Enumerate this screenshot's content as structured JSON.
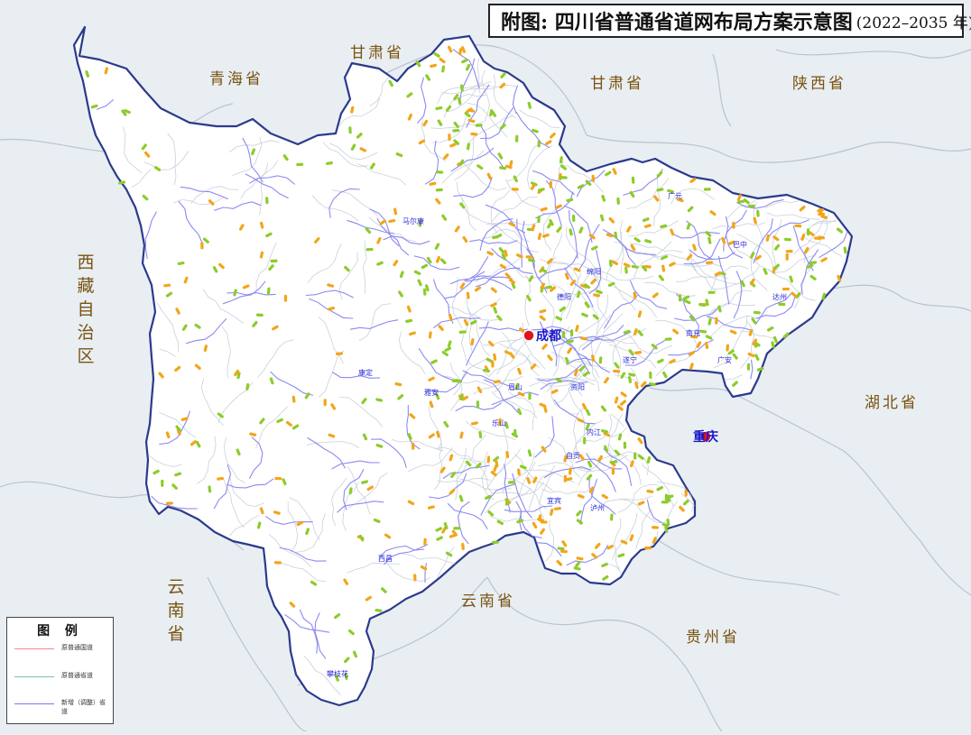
{
  "title": {
    "main": "附图: 四川省普通省道网布局方案示意图",
    "years": "(2022–2035 年)"
  },
  "neighbors": {
    "qinghai": "青海省",
    "gansu_north": "甘肃省",
    "gansu_east": "甘肃省",
    "shaanxi": "陕西省",
    "tibet_chars": [
      "西",
      "藏",
      "自",
      "治",
      "区"
    ],
    "hubei": "湖北省",
    "yunnan_west_chars": [
      "云",
      "南",
      "省"
    ],
    "yunnan_south": "云南省",
    "guizhou": "贵州省"
  },
  "cities": {
    "chengdu": "成都",
    "chongqing": "重庆",
    "guangyuan": "广元",
    "bazhong": "巴中",
    "mianyang": "绵阳",
    "deyang": "德阳",
    "dazhou": "达州",
    "nanchong": "南充",
    "suining": "遂宁",
    "guangan": "广安",
    "ziyang": "资阳",
    "meishan": "眉山",
    "yaan": "雅安",
    "leshan": "乐山",
    "neijiang": "内江",
    "zigong": "自贡",
    "yibin": "宜宾",
    "luzhou": "泸州",
    "maerkang": "马尔康",
    "kangding": "康定",
    "xichang": "西昌",
    "panzhihua": "攀枝花"
  },
  "legend": {
    "title": "图 例",
    "items": [
      {
        "label": "原普通国道",
        "color": "#f28a8a"
      },
      {
        "label": "原普通省道",
        "color": "#7cc0a8"
      },
      {
        "label": "新增（调整）省道",
        "color": "#7a78f0"
      }
    ]
  },
  "colors": {
    "sea": "#e9eef3",
    "province_fill": "#ffffff",
    "province_border": "#2b3a8c",
    "neighbor_border": "#b9c3cf",
    "label_brown": "#7a5410",
    "capital_red": "#e0141e",
    "marker_green": "#8ccc2a",
    "marker_orange": "#f2a51a"
  }
}
